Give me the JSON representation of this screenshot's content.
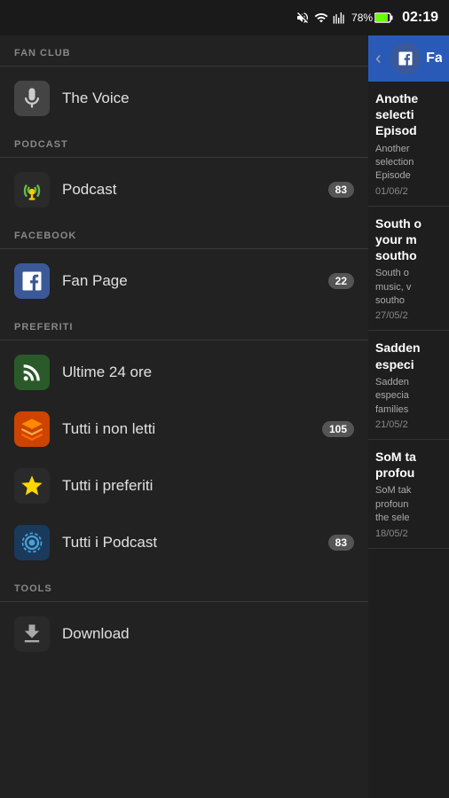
{
  "statusBar": {
    "time": "02:19",
    "battery": "78%",
    "icons": [
      "mute",
      "wifi",
      "signal"
    ]
  },
  "sidebar": {
    "sections": [
      {
        "id": "fan-club",
        "label": "FAN CLUB",
        "items": [
          {
            "id": "the-voice",
            "label": "The Voice",
            "icon": "microphone",
            "badge": null
          }
        ]
      },
      {
        "id": "podcast",
        "label": "PODCAST",
        "items": [
          {
            "id": "podcast",
            "label": "Podcast",
            "icon": "podcast",
            "badge": "83"
          }
        ]
      },
      {
        "id": "facebook",
        "label": "FACEBOOK",
        "items": [
          {
            "id": "fan-page",
            "label": "Fan Page",
            "icon": "facebook",
            "badge": "22"
          }
        ]
      },
      {
        "id": "preferiti",
        "label": "PREFERITI",
        "items": [
          {
            "id": "ultime-24",
            "label": "Ultime 24 ore",
            "icon": "rss",
            "badge": null
          },
          {
            "id": "tutti-non-letti",
            "label": "Tutti i non letti",
            "icon": "unread",
            "badge": "105"
          },
          {
            "id": "tutti-preferiti",
            "label": "Tutti i preferiti",
            "icon": "star",
            "badge": null
          },
          {
            "id": "tutti-podcast",
            "label": "Tutti i Podcast",
            "icon": "podcasts",
            "badge": "83"
          }
        ]
      },
      {
        "id": "tools",
        "label": "TOOLS",
        "items": [
          {
            "id": "download",
            "label": "Download",
            "icon": "download",
            "badge": null
          }
        ]
      }
    ]
  },
  "rightPanel": {
    "header": {
      "title": "Fa",
      "icon": "facebook"
    },
    "feedItems": [
      {
        "id": "item1",
        "title": "Anothe selecri Episod",
        "desc": "Another selection Episode",
        "date": "01/06/2"
      },
      {
        "id": "item2",
        "title": "South o your m southo",
        "desc": "South o music, v southo",
        "date": "27/05/2"
      },
      {
        "id": "item3",
        "title": "Sadden especi",
        "desc": "Sadden especia families",
        "date": "21/05/2"
      },
      {
        "id": "item4",
        "title": "SoM ta profou",
        "desc": "SoM tak profoun the sele",
        "date": "18/05/2"
      }
    ]
  }
}
